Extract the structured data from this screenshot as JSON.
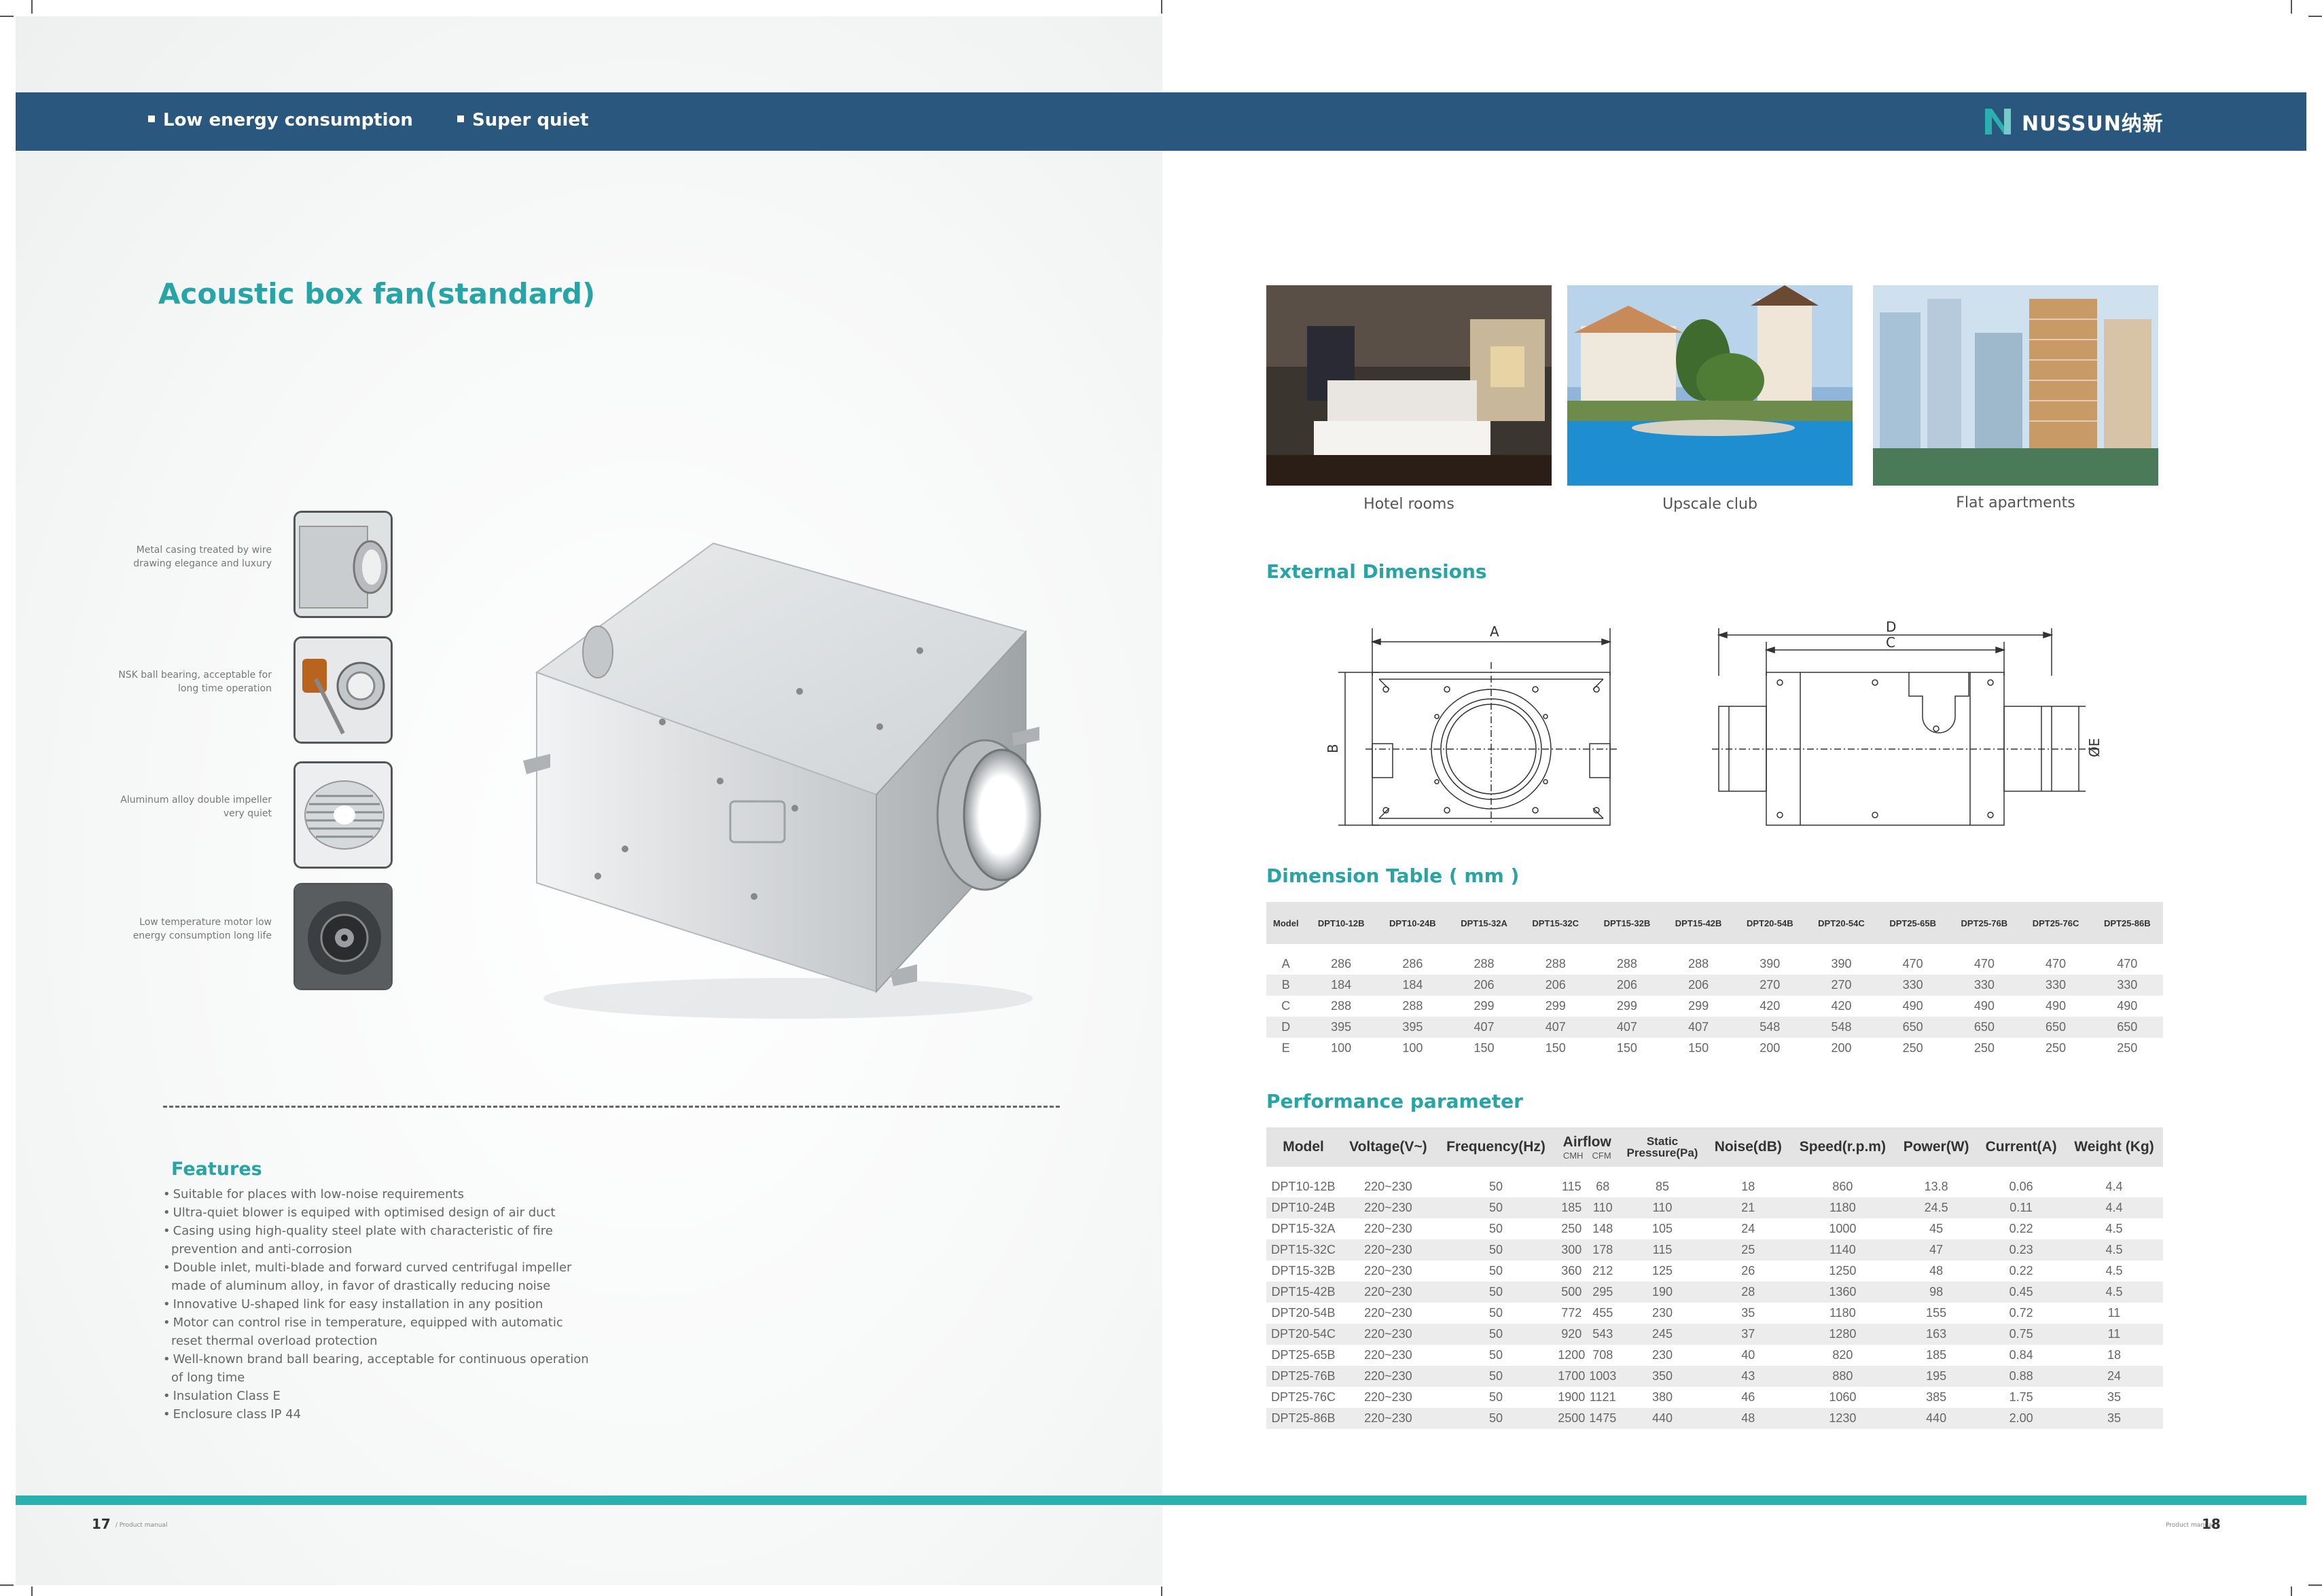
{
  "topbar": {
    "items": [
      "Low energy consumption",
      "Super quiet"
    ],
    "brand": "NUSSUN纳新",
    "brand_color": "#2a577d"
  },
  "left": {
    "title": "Acoustic box fan(standard)",
    "features_callouts": [
      {
        "text": "Metal casing treated by wire drawing elegance and luxury",
        "icon": "casing-icon"
      },
      {
        "text": "NSK ball bearing, acceptable for long time operation",
        "icon": "bearing-icon"
      },
      {
        "text": "Aluminum alloy double impeller very quiet",
        "icon": "impeller-icon"
      },
      {
        "text": "Low temperature motor low energy consumption long life",
        "icon": "motor-icon"
      }
    ],
    "features_title": "Features",
    "features": [
      "Suitable for places with low-noise requirements",
      "Ultra-quiet blower is equiped with optimised design of air duct",
      "Casing using high-quality steel plate with characteristic of fire prevention and anti-corrosion",
      "Double inlet, multi-blade and forward curved centrifugal impeller made of aluminum alloy, in favor of drastically reducing noise",
      "Innovative U-shaped link for easy installation in any position",
      "Motor can control rise in temperature, equipped with automatic reset thermal overload protection",
      "Well-known brand ball bearing, acceptable for continuous operation of long time",
      "Insulation Class E",
      "Enclosure class IP 44"
    ],
    "page_number": "17",
    "page_note": "/ Product manual"
  },
  "right": {
    "photos": [
      {
        "caption": "Hotel rooms"
      },
      {
        "caption": "Upscale club"
      },
      {
        "caption": "Flat apartments"
      }
    ],
    "external_title": "External Dimensions",
    "drawing_labels": {
      "a": "A",
      "b": "B",
      "c": "C",
      "d": "D",
      "e": "ØE"
    },
    "dim_title": "Dimension Table ( mm )",
    "dim_table": {
      "header": [
        "Model",
        "DPT10-12B",
        "DPT10-24B",
        "DPT15-32A",
        "DPT15-32C",
        "DPT15-32B",
        "DPT15-42B",
        "DPT20-54B",
        "DPT20-54C",
        "DPT25-65B",
        "DPT25-76B",
        "DPT25-76C",
        "DPT25-86B"
      ],
      "rows": [
        [
          "A",
          "286",
          "286",
          "288",
          "288",
          "288",
          "288",
          "390",
          "390",
          "470",
          "470",
          "470",
          "470"
        ],
        [
          "B",
          "184",
          "184",
          "206",
          "206",
          "206",
          "206",
          "270",
          "270",
          "330",
          "330",
          "330",
          "330"
        ],
        [
          "C",
          "288",
          "288",
          "299",
          "299",
          "299",
          "299",
          "420",
          "420",
          "490",
          "490",
          "490",
          "490"
        ],
        [
          "D",
          "395",
          "395",
          "407",
          "407",
          "407",
          "407",
          "548",
          "548",
          "650",
          "650",
          "650",
          "650"
        ],
        [
          "E",
          "100",
          "100",
          "150",
          "150",
          "150",
          "150",
          "200",
          "200",
          "250",
          "250",
          "250",
          "250"
        ]
      ]
    },
    "perf_title": "Performance parameter",
    "perf_table": {
      "header": {
        "model": "Model",
        "voltage": "Voltage(V~)",
        "frequency": "Frequency(Hz)",
        "airflow": "Airflow",
        "airflow_cmh": "CMH",
        "airflow_cfm": "CFM",
        "static_1": "Static",
        "static_2": "Pressure(Pa)",
        "noise": "Noise(dB)",
        "speed": "Speed(r.p.m)",
        "power": "Power(W)",
        "current": "Current(A)",
        "weight": "Weight (Kg)"
      },
      "rows": [
        [
          "DPT10-12B",
          "220~230",
          "50",
          "115",
          "68",
          "85",
          "18",
          "860",
          "13.8",
          "0.06",
          "4.4"
        ],
        [
          "DPT10-24B",
          "220~230",
          "50",
          "185",
          "110",
          "110",
          "21",
          "1180",
          "24.5",
          "0.11",
          "4.4"
        ],
        [
          "DPT15-32A",
          "220~230",
          "50",
          "250",
          "148",
          "105",
          "24",
          "1000",
          "45",
          "0.22",
          "4.5"
        ],
        [
          "DPT15-32C",
          "220~230",
          "50",
          "300",
          "178",
          "115",
          "25",
          "1140",
          "47",
          "0.23",
          "4.5"
        ],
        [
          "DPT15-32B",
          "220~230",
          "50",
          "360",
          "212",
          "125",
          "26",
          "1250",
          "48",
          "0.22",
          "4.5"
        ],
        [
          "DPT15-42B",
          "220~230",
          "50",
          "500",
          "295",
          "190",
          "28",
          "1360",
          "98",
          "0.45",
          "4.5"
        ],
        [
          "DPT20-54B",
          "220~230",
          "50",
          "772",
          "455",
          "230",
          "35",
          "1180",
          "155",
          "0.72",
          "11"
        ],
        [
          "DPT20-54C",
          "220~230",
          "50",
          "920",
          "543",
          "245",
          "37",
          "1280",
          "163",
          "0.75",
          "11"
        ],
        [
          "DPT25-65B",
          "220~230",
          "50",
          "1200",
          "708",
          "230",
          "40",
          "820",
          "185",
          "0.84",
          "18"
        ],
        [
          "DPT25-76B",
          "220~230",
          "50",
          "1700",
          "1003",
          "350",
          "43",
          "880",
          "195",
          "0.88",
          "24"
        ],
        [
          "DPT25-76C",
          "220~230",
          "50",
          "1900",
          "1121",
          "380",
          "46",
          "1060",
          "385",
          "1.75",
          "35"
        ],
        [
          "DPT25-86B",
          "220~230",
          "50",
          "2500",
          "1475",
          "440",
          "48",
          "1230",
          "440",
          "2.00",
          "35"
        ]
      ]
    },
    "page_number": "18",
    "page_note": "Product manual \\"
  },
  "colors": {
    "accent": "#27a4a5",
    "bar": "#2a577d",
    "footer_bar": "#2ab0ae"
  }
}
